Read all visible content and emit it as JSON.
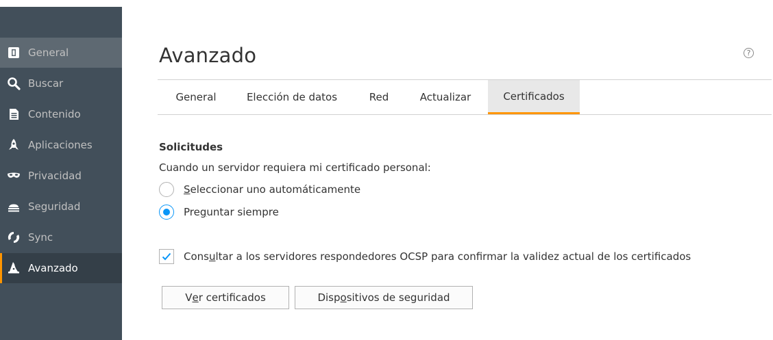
{
  "sidebar": {
    "items": [
      {
        "label": "General",
        "icon": "general-icon"
      },
      {
        "label": "Buscar",
        "icon": "search-icon"
      },
      {
        "label": "Contenido",
        "icon": "document-icon"
      },
      {
        "label": "Aplicaciones",
        "icon": "rocket-icon"
      },
      {
        "label": "Privacidad",
        "icon": "mask-icon"
      },
      {
        "label": "Seguridad",
        "icon": "security-icon"
      },
      {
        "label": "Sync",
        "icon": "sync-icon"
      },
      {
        "label": "Avanzado",
        "icon": "wizard-hat-icon"
      }
    ],
    "active": "Avanzado",
    "colors": {
      "bg": "#424f5a",
      "active_bg": "#343f48",
      "hover_bg": "#5e6972",
      "accent": "#ff9500"
    }
  },
  "header": {
    "title": "Avanzado",
    "help_label": "?"
  },
  "tabs": {
    "items": [
      "General",
      "Elección de datos",
      "Red",
      "Actualizar",
      "Certificados"
    ],
    "active": "Certificados"
  },
  "requests": {
    "title": "Solicitudes",
    "description": "Cuando un servidor requiera mi certificado personal:",
    "options": [
      {
        "label_pre": "",
        "label_ul": "S",
        "label_post": "eleccionar uno automáticamente",
        "checked": false
      },
      {
        "label_pre": "Pre",
        "label_ul": "g",
        "label_post": "untar siempre",
        "checked": true
      }
    ]
  },
  "ocsp": {
    "label_pre": "Cons",
    "label_ul": "u",
    "label_post": "ltar a los servidores respondedores OCSP para confirmar la validez actual de los certificados",
    "checked": true
  },
  "buttons": {
    "view_certs": {
      "pre": "V",
      "ul": "e",
      "post": "r certificados"
    },
    "security_devices": {
      "pre": "Disp",
      "ul": "o",
      "post": "sitivos de seguridad"
    }
  },
  "colors": {
    "check_blue": "#0996f8"
  }
}
